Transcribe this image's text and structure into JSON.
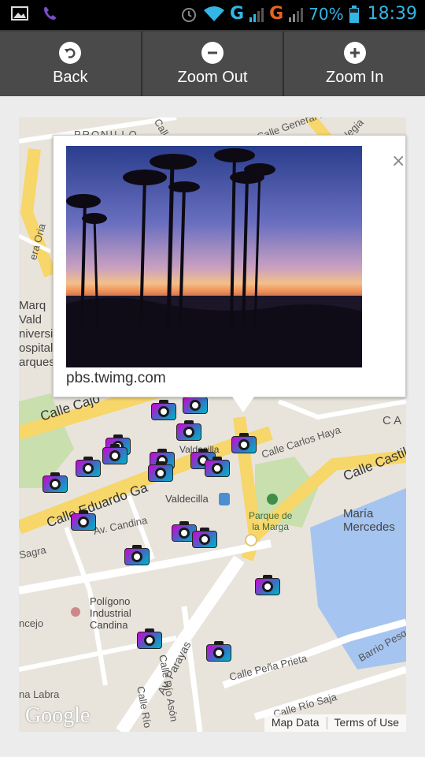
{
  "status_bar": {
    "net1": "G",
    "net2": "G",
    "battery": "70%",
    "time": "18:39",
    "icons": [
      "picture-icon",
      "viber-icon",
      "alarm-icon",
      "wifi-icon",
      "signal-icon",
      "battery-icon"
    ]
  },
  "toolbar": {
    "back_label": "Back",
    "zoom_out_label": "Zoom Out",
    "zoom_in_label": "Zoom In"
  },
  "map": {
    "streets": {
      "calle_cajo": "Calle Cajo",
      "calle_eduardo": "Calle Eduardo Ga",
      "av_candina": "Av. Candina",
      "calle_carlos_haya": "Calle Carlos Haya",
      "calle_castilla": "Calle Castil",
      "av_parayas": "Av. Parayas",
      "calle_rio_ason": "Calle Río Asón",
      "calle_pena_prieta": "Calle Peña Prieta",
      "calle_rio_saja": "Calle Río Saja",
      "barrio_pesq": "Barrio Pesq",
      "calle_rio": "Calle Río",
      "calle_labra": "na Labra",
      "sagra": "Sagra",
      "pronillo": "PRONILLO",
      "calle_general": "Calle General D",
      "calle_top": "Calle",
      "calle_legia": "legia",
      "ca_right": "C A",
      "vera_oria": "era Oria",
      "concejo": "ncejo"
    },
    "pois": {
      "valdecilla": "Valdecilla",
      "valdecilla2": "Valdecilla",
      "parque": "Parque de\nla Marga",
      "maria_mercedes": "María\nMercedes",
      "poligono": "Polígono\nIndustrial\nCandina",
      "marques": "Marq\nVald\nniversi\nospital\narques"
    },
    "logo": "Google",
    "map_data_label": "Map Data",
    "terms_label": "Terms of Use",
    "colors": {
      "road": "#f7d66a",
      "land": "#e8e4dc",
      "water": "#a5c4f0",
      "park": "#c9dfae"
    }
  },
  "info_window": {
    "caption": "pbs.twimg.com",
    "close_glyph": "×"
  }
}
